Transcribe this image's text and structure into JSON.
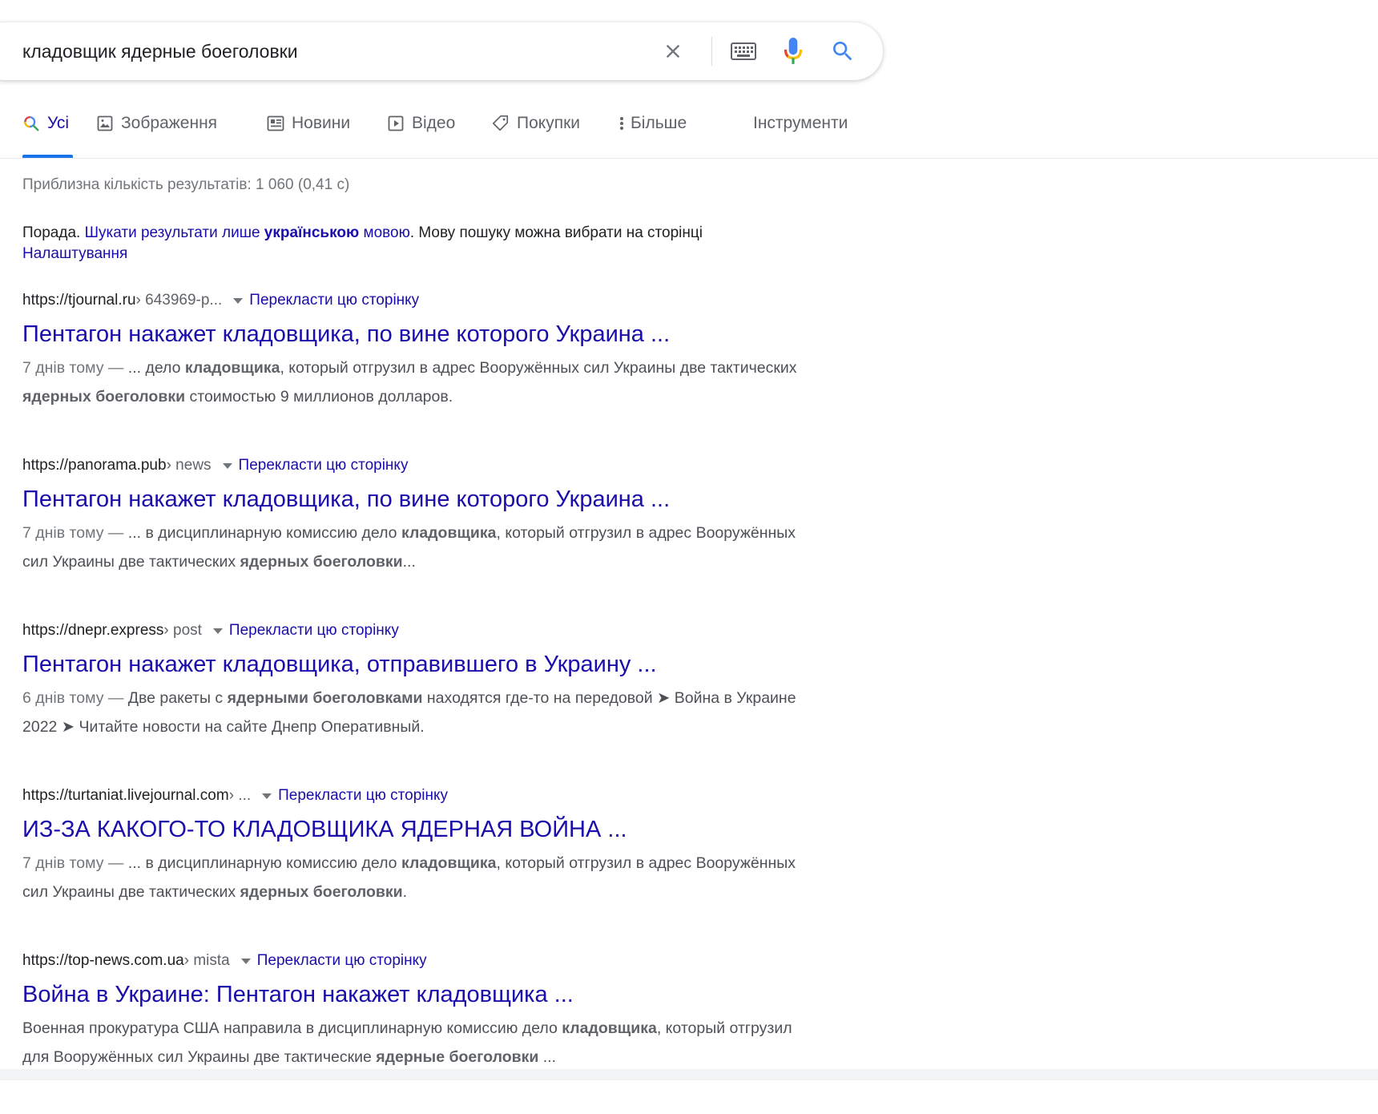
{
  "search": {
    "query": "кладовщик ядерные боеголовки"
  },
  "tabs": [
    {
      "label": "Усі",
      "icon": "search-multicolor-icon",
      "active": true
    },
    {
      "label": "Зображення",
      "icon": "image-icon"
    },
    {
      "label": "Новини",
      "icon": "news-icon"
    },
    {
      "label": "Відео",
      "icon": "video-icon"
    },
    {
      "label": "Покупки",
      "icon": "tag-icon"
    },
    {
      "label": "Більше",
      "icon": "more-vert-icon"
    },
    {
      "label": "Інструменти"
    }
  ],
  "stats": "Приблизна кількість результатів: 1 060 (0,41 с)",
  "tip": {
    "prefix": "Порада.",
    "link_a": "Шукати результати лише",
    "link_bold": "українською",
    "link_b": "мовою",
    "middle": ". Мову пошуку можна вибрати на сторінці",
    "settings_link": "Налаштування"
  },
  "colors": {
    "link": "#1a0dab",
    "accent": "#1a73e8",
    "muted": "#70757a"
  },
  "results": [
    {
      "domain": "https://tjournal.ru",
      "path": " › 643969-p...",
      "translate": "Перекласти цю сторінку",
      "title": "Пентагон накажет кладовщика, по вине которого Украина ...",
      "date": "7 днів тому — ",
      "snippet_parts": [
        {
          "t": "... дело "
        },
        {
          "t": "кладовщика",
          "b": true
        },
        {
          "t": ", который отгрузил в адрес Вооружённых сил Украины две тактических "
        },
        {
          "t": "ядерных боеголовки",
          "b": true
        },
        {
          "t": " стоимостью 9 миллионов долларов."
        }
      ]
    },
    {
      "domain": "https://panorama.pub",
      "path": " › news",
      "translate": "Перекласти цю сторінку",
      "title": "Пентагон накажет кладовщика, по вине которого Украина ...",
      "date": "7 днів тому — ",
      "snippet_parts": [
        {
          "t": "... в дисциплинарную комиссию дело "
        },
        {
          "t": "кладовщика",
          "b": true
        },
        {
          "t": ", который отгрузил в адрес Вооружённых сил Украины две тактических "
        },
        {
          "t": "ядерных боеголовки",
          "b": true
        },
        {
          "t": "..."
        }
      ]
    },
    {
      "domain": "https://dnepr.express",
      "path": " › post",
      "translate": "Перекласти цю сторінку",
      "title": "Пентагон накажет кладовщика, отправившего в Украину ...",
      "date": "6 днів тому — ",
      "snippet_parts": [
        {
          "t": "Две ракеты с "
        },
        {
          "t": "ядерными боеголовками",
          "b": true
        },
        {
          "t": " находятся где-то на передовой ➤ Война в Украине 2022 ➤ Читайте новости на сайте Днепр Оперативный."
        }
      ]
    },
    {
      "domain": "https://turtaniat.livejournal.com",
      "path": " › ...",
      "translate": "Перекласти цю сторінку",
      "title": "ИЗ-ЗА КАКОГО-ТО КЛАДОВЩИКА ЯДЕРНАЯ ВОЙНА ...",
      "date": "7 днів тому — ",
      "snippet_parts": [
        {
          "t": "... в дисциплинарную комиссию дело "
        },
        {
          "t": "кладовщика",
          "b": true
        },
        {
          "t": ", который отгрузил в адрес Вооружённых сил Украины две тактических "
        },
        {
          "t": "ядерных боеголовки",
          "b": true
        },
        {
          "t": "."
        }
      ]
    },
    {
      "domain": "https://top-news.com.ua",
      "path": " › mista",
      "translate": "Перекласти цю сторінку",
      "title": "Война в Украине: Пентагон накажет кладовщика ...",
      "date": "",
      "snippet_parts": [
        {
          "t": "Военная прокуратура США направила в дисциплинарную комиссию дело "
        },
        {
          "t": "кладовщика",
          "b": true
        },
        {
          "t": ", который отгрузил для Вооружённых сил Украины две тактические "
        },
        {
          "t": "ядерные боеголовки",
          "b": true
        },
        {
          "t": " ..."
        }
      ]
    }
  ]
}
